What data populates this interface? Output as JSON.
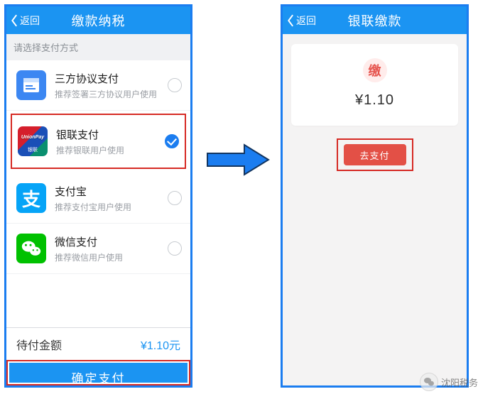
{
  "left": {
    "back": "返回",
    "title": "缴款纳税",
    "section_label": "请选择支付方式",
    "options": [
      {
        "name": "三方协议支付",
        "sub": "推荐签署三方协议用户使用"
      },
      {
        "name": "银联支付",
        "sub": "推荐银联用户使用"
      },
      {
        "name": "支付宝",
        "sub": "推荐支付宝用户使用"
      },
      {
        "name": "微信支付",
        "sub": "推荐微信用户使用"
      }
    ],
    "amount_label": "待付金额",
    "amount_value": "¥1.10元",
    "confirm": "确定支付"
  },
  "right": {
    "back": "返回",
    "title": "银联缴款",
    "badge": "缴",
    "price": "¥1.10",
    "pay_button": "去支付"
  },
  "watermark": "沈阳税务",
  "unionpay_cn": "银联",
  "unionpay_en": "UnionPay"
}
